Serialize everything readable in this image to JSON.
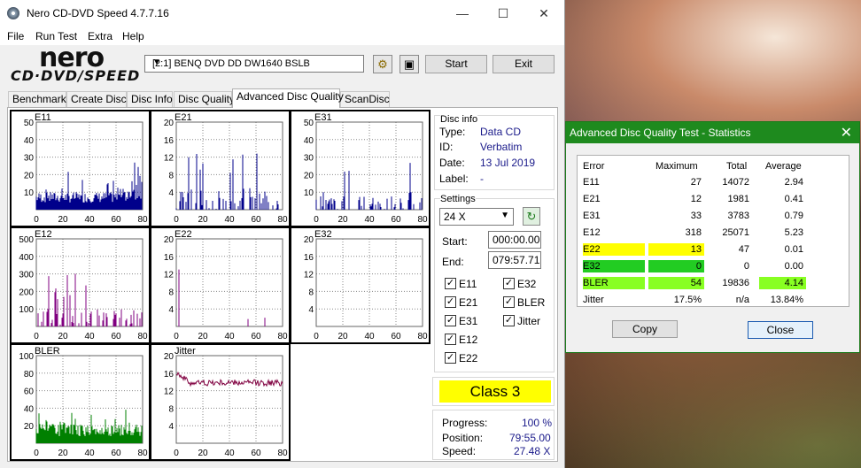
{
  "window": {
    "title": "Nero CD-DVD Speed 4.7.7.16",
    "minimize": "—",
    "maximize": "☐",
    "close": "✕"
  },
  "menu": [
    "File",
    "Run Test",
    "Extra",
    "Help"
  ],
  "logo": {
    "top": "nero",
    "bottom": "CD·DVD/SPEED"
  },
  "toolbar": {
    "drive": "[2:1]   BENQ DVD DD DW1640 BSLB",
    "start": "Start",
    "exit": "Exit"
  },
  "tabs": [
    "Benchmark",
    "Create Disc",
    "Disc Info",
    "Disc Quality",
    "Advanced Disc Quality",
    "ScanDisc"
  ],
  "active_tab": "Advanced Disc Quality",
  "disc_info": {
    "title": "Disc info",
    "type_label": "Type:",
    "type": "Data CD",
    "id_label": "ID:",
    "id": "Verbatim",
    "date_label": "Date:",
    "date": "13 Jul 2019",
    "label_label": "Label:",
    "label": "-"
  },
  "settings": {
    "title": "Settings",
    "speed": "24 X",
    "start_label": "Start:",
    "start": "000:00.00",
    "end_label": "End:",
    "end": "079:57.71",
    "checks": [
      {
        "label": "E11",
        "checked": true
      },
      {
        "label": "E32",
        "checked": true
      },
      {
        "label": "E21",
        "checked": true
      },
      {
        "label": "BLER",
        "checked": true
      },
      {
        "label": "E31",
        "checked": true
      },
      {
        "label": "Jitter",
        "checked": true
      },
      {
        "label": "E12",
        "checked": true
      },
      {
        "label": "E22",
        "checked": true
      }
    ]
  },
  "class_label": "Class 3",
  "progress": {
    "progress_label": "Progress:",
    "progress": "100 %",
    "position_label": "Position:",
    "position": "79:55.00",
    "speed_label": "Speed:",
    "speed": "27.48 X"
  },
  "chart_data": [
    {
      "type": "bar",
      "title": "E11",
      "ylim": [
        0,
        50
      ],
      "yticks": [
        10,
        20,
        30,
        40,
        50
      ],
      "xticks": [
        0,
        20,
        40,
        60,
        80
      ],
      "color": "#00008b"
    },
    {
      "type": "bar",
      "title": "E21",
      "ylim": [
        0,
        20
      ],
      "yticks": [
        4,
        8,
        12,
        16,
        20
      ],
      "xticks": [
        0,
        20,
        40,
        60,
        80
      ],
      "color": "#00008b"
    },
    {
      "type": "bar",
      "title": "E31",
      "ylim": [
        0,
        50
      ],
      "yticks": [
        10,
        20,
        30,
        40,
        50
      ],
      "xticks": [
        0,
        20,
        40,
        60,
        80
      ],
      "color": "#00008b"
    },
    {
      "type": "bar",
      "title": "E12",
      "ylim": [
        0,
        500
      ],
      "yticks": [
        100,
        200,
        300,
        400,
        500
      ],
      "xticks": [
        0,
        20,
        40,
        60,
        80
      ],
      "color": "#800080"
    },
    {
      "type": "bar",
      "title": "E22",
      "ylim": [
        0,
        20
      ],
      "yticks": [
        4,
        8,
        12,
        16,
        20
      ],
      "xticks": [
        0,
        20,
        40,
        60,
        80
      ],
      "color": "#800080"
    },
    {
      "type": "bar",
      "title": "E32",
      "ylim": [
        0,
        20
      ],
      "yticks": [
        4,
        8,
        12,
        16,
        20
      ],
      "xticks": [
        0,
        20,
        40,
        60,
        80
      ],
      "color": "#800080"
    },
    {
      "type": "bar",
      "title": "BLER",
      "ylim": [
        0,
        100
      ],
      "yticks": [
        20,
        40,
        60,
        80,
        100
      ],
      "xticks": [
        0,
        20,
        40,
        60,
        80
      ],
      "color": "#008000"
    },
    {
      "type": "line",
      "title": "Jitter",
      "ylim": [
        0,
        20
      ],
      "yticks": [
        4,
        8,
        12,
        16,
        20
      ],
      "xticks": [
        0,
        20,
        40,
        60,
        80
      ],
      "color": "#800040"
    }
  ],
  "stats": {
    "title": "Advanced Disc Quality Test - Statistics",
    "headers": [
      "Error",
      "Maximum",
      "Total",
      "Average"
    ],
    "rows": [
      {
        "error": "E11",
        "maximum": "27",
        "total": "14072",
        "average": "2.94"
      },
      {
        "error": "E21",
        "maximum": "12",
        "total": "1981",
        "average": "0.41"
      },
      {
        "error": "E31",
        "maximum": "33",
        "total": "3783",
        "average": "0.79"
      },
      {
        "error": "E12",
        "maximum": "318",
        "total": "25071",
        "average": "5.23"
      },
      {
        "error": "E22",
        "maximum": "13",
        "total": "47",
        "average": "0.01"
      },
      {
        "error": "E32",
        "maximum": "0",
        "total": "0",
        "average": "0.00"
      },
      {
        "error": "BLER",
        "maximum": "54",
        "total": "19836",
        "average": "4.14"
      },
      {
        "error": "Jitter",
        "maximum": "17.5%",
        "total": "n/a",
        "average": "13.84%"
      }
    ],
    "copy": "Copy",
    "close": "Close"
  }
}
